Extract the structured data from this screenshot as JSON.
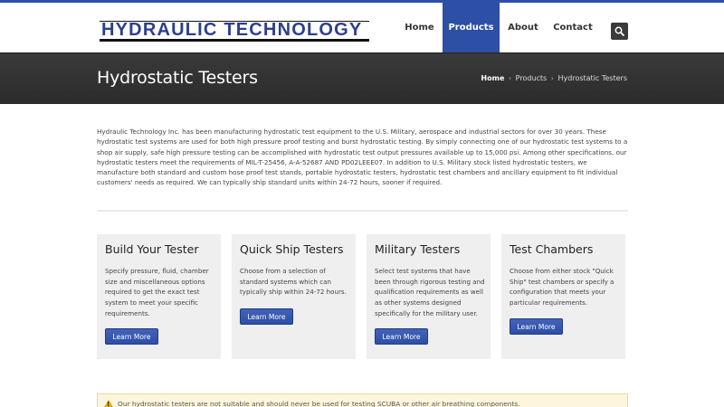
{
  "brand": {
    "logo_text": "HYDRAULIC TECHNOLOGY"
  },
  "nav": {
    "items": [
      {
        "label": "Home",
        "active": false
      },
      {
        "label": "Products",
        "active": true
      },
      {
        "label": "About",
        "active": false
      },
      {
        "label": "Contact",
        "active": false
      }
    ],
    "search_icon": "search-icon"
  },
  "page": {
    "title": "Hydrostatic Testers",
    "breadcrumb": {
      "home": "Home",
      "products": "Products",
      "current": "Hydrostatic Testers",
      "separator": "›"
    }
  },
  "intro": "Hydraulic Technology Inc. has been manufacturing hydrostatic test equipment to the U.S. Military, aerospace and industrial sectors for over 30 years. These hydrostatic test systems are used for both high pressure proof testing and burst hydrostatic testing. By simply connecting one of our hydrostatic test systems to a shop air supply, safe high pressure testing can be accomplished with hydrostatic test output pressures available up to 15,000 psi. Among other specifications, our hydrostatic testers meet the requirements of MIL-T-25456, A-A-52687 AND PD02LEEE07. In addition to U.S. Military stock listed hydrostatic testers, we manufacture both standard and custom hose proof test stands, portable hydrostatic testers, hydrostatic test chambers and ancillary equipment to fit individual customers' needs as required. We can typically ship standard units within 24-72 hours, sooner if required.",
  "cards": [
    {
      "title": "Build Your Tester",
      "text": "Specify pressure, fluid, chamber size and miscellaneous options required to get the exact test system to meet your specific requirements.",
      "button": "Learn More"
    },
    {
      "title": "Quick Ship Testers",
      "text": "Choose from a selection of standard systems which can typically ship within 24-72 hours.",
      "button": "Learn More"
    },
    {
      "title": "Military Testers",
      "text": "Select test systems that have been through rigorous testing and qualification requirements as well as other systems designed specifically for the military user.",
      "button": "Learn More"
    },
    {
      "title": "Test Chambers",
      "text": "Choose from either stock \"Quick Ship\" test chambers or specify a configuration that meets your particular requirements.",
      "button": "Learn More"
    }
  ],
  "notice": {
    "icon": "warning-icon",
    "text": "Our hydrostatic testers are not suitable and should never be used for testing SCUBA or other air breathing components."
  },
  "colors": {
    "accent": "#2d4fa6",
    "band": "#2f2f2f",
    "card_bg": "#efefef",
    "notice_bg": "#fdf6dc"
  }
}
